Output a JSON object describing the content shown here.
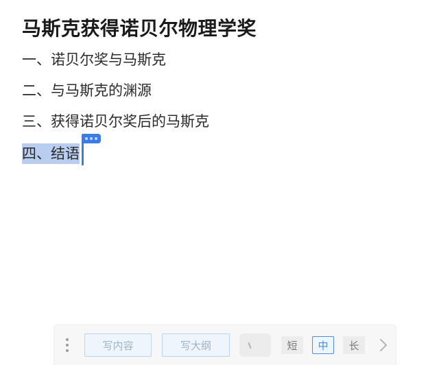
{
  "document": {
    "title": "马斯克获得诺贝尔物理学奖",
    "outline": [
      "一、诺贝尔奖与马斯克",
      "二、与马斯克的渊源",
      "三、获得诺贝尔奖后的马斯克",
      "四、结语"
    ],
    "selected_line_index": 3
  },
  "toolbar": {
    "write_content_label": "写内容",
    "write_outline_label": "写大纲",
    "length_options": [
      "短",
      "中",
      "长"
    ],
    "selected_length": "中",
    "drag_icon": "drag-handle-icon",
    "next_icon": "chevron-right-icon"
  },
  "colors": {
    "selection": "#b9cdf0",
    "caret": "#3b7de8",
    "accent": "#4a8fd9"
  }
}
